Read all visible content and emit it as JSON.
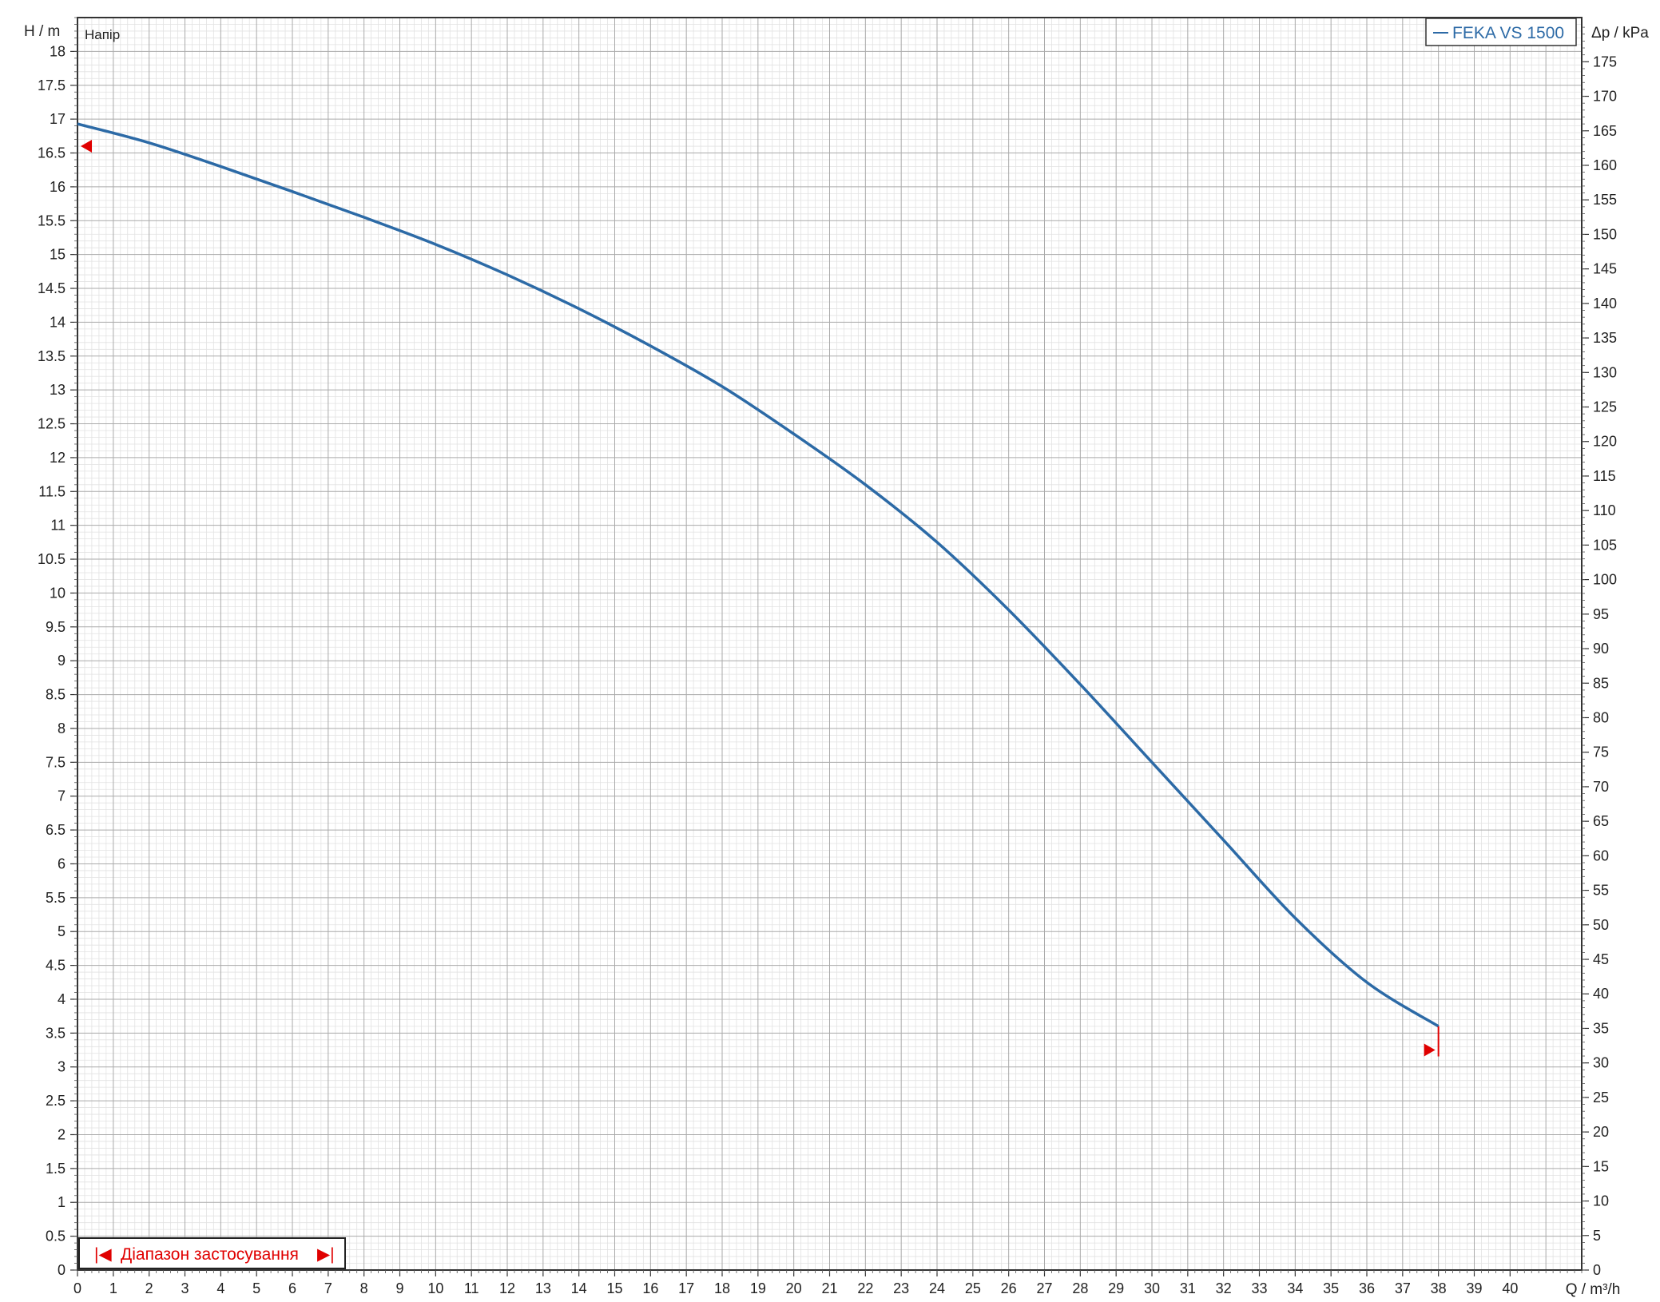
{
  "chart_data": {
    "type": "line",
    "title": "",
    "xlabel": "Q / m³/h",
    "ylabel": "H / m",
    "y2label": "Δp / kPa",
    "annotation": "Напір",
    "xlim": [
      0,
      42
    ],
    "ylim": [
      0,
      18.5
    ],
    "y2lim": [
      0,
      181.4
    ],
    "x_ticks": [
      0,
      1,
      2,
      3,
      4,
      5,
      6,
      7,
      8,
      9,
      10,
      11,
      12,
      13,
      14,
      15,
      16,
      17,
      18,
      19,
      20,
      21,
      22,
      23,
      24,
      25,
      26,
      27,
      28,
      29,
      30,
      31,
      32,
      33,
      34,
      35,
      36,
      37,
      38,
      39,
      40
    ],
    "y_ticks": [
      0,
      0.5,
      1,
      1.5,
      2,
      2.5,
      3,
      3.5,
      4,
      4.5,
      5,
      5.5,
      6,
      6.5,
      7,
      7.5,
      8,
      8.5,
      9,
      9.5,
      10,
      10.5,
      11,
      11.5,
      12,
      12.5,
      13,
      13.5,
      14,
      14.5,
      15,
      15.5,
      16,
      16.5,
      17,
      17.5,
      18
    ],
    "y2_ticks": [
      0,
      5,
      10,
      15,
      20,
      25,
      30,
      35,
      40,
      45,
      50,
      55,
      60,
      65,
      70,
      75,
      80,
      85,
      90,
      95,
      100,
      105,
      110,
      115,
      120,
      125,
      130,
      135,
      140,
      145,
      150,
      155,
      160,
      165,
      170,
      175
    ],
    "grid": true,
    "legend_position": "top-right",
    "series": [
      {
        "name": "FEKA VS 1500",
        "color": "#2c6aa6",
        "x": [
          0,
          2,
          4,
          6,
          8,
          10,
          12,
          14,
          16,
          18,
          20,
          22,
          24,
          26,
          28,
          30,
          32,
          34,
          36,
          38
        ],
        "y": [
          16.93,
          16.65,
          16.3,
          15.93,
          15.55,
          15.15,
          14.7,
          14.2,
          13.65,
          13.05,
          12.35,
          11.6,
          10.75,
          9.75,
          8.65,
          7.5,
          6.35,
          5.2,
          4.25,
          3.6
        ]
      }
    ],
    "operating_range": {
      "label": "Діапазон застосування",
      "start": 0,
      "end": 38,
      "start_marker_y": 16.6,
      "end_marker_y": 3.25,
      "color": "#e00000"
    }
  }
}
